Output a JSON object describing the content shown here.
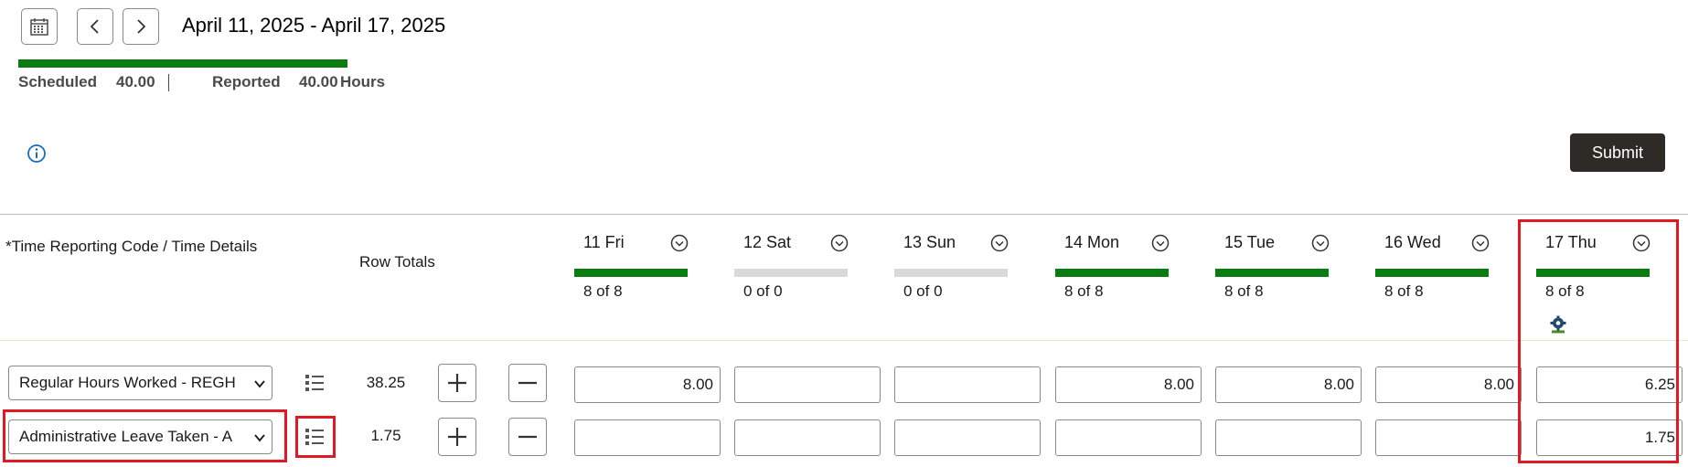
{
  "header": {
    "date_range": "April 11, 2025 - April 17, 2025",
    "scheduled_label": "Scheduled",
    "scheduled_value": "40.00",
    "reported_label": "Reported",
    "reported_value": "40.00",
    "hours_label": "Hours",
    "summary_progress": 1.0,
    "submit_label": "Submit"
  },
  "table": {
    "trc_header": "*Time Reporting Code / Time Details",
    "row_totals_header": "Row Totals",
    "days": [
      {
        "label": "11 Fri",
        "status": "8 of 8",
        "fill": 1.0
      },
      {
        "label": "12 Sat",
        "status": "0 of 0",
        "fill": 0
      },
      {
        "label": "13 Sun",
        "status": "0 of 0",
        "fill": 0
      },
      {
        "label": "14 Mon",
        "status": "8 of 8",
        "fill": 1.0
      },
      {
        "label": "15 Tue",
        "status": "8 of 8",
        "fill": 1.0
      },
      {
        "label": "16 Wed",
        "status": "8 of 8",
        "fill": 1.0
      },
      {
        "label": "17 Thu",
        "status": "8 of 8",
        "fill": 1.0
      }
    ],
    "rows": [
      {
        "trc": "Regular Hours Worked - REGH",
        "total": "38.25",
        "values": [
          "8.00",
          "",
          "",
          "8.00",
          "8.00",
          "8.00",
          "6.25"
        ]
      },
      {
        "trc": "Administrative Leave Taken - A",
        "total": "1.75",
        "values": [
          "",
          "",
          "",
          "",
          "",
          "",
          "1.75"
        ]
      }
    ]
  },
  "colors": {
    "accent_green": "#0a7c12",
    "empty_bar": "#d9d9d9",
    "highlight_red": "#e01a22",
    "submit_bg": "#2e2a26"
  },
  "icons": [
    "calendar-icon",
    "chevron-left-icon",
    "chevron-right-icon",
    "info-icon",
    "chevron-down-circle-icon",
    "gear-icon",
    "details-list-icon",
    "plus-icon",
    "minus-icon"
  ]
}
